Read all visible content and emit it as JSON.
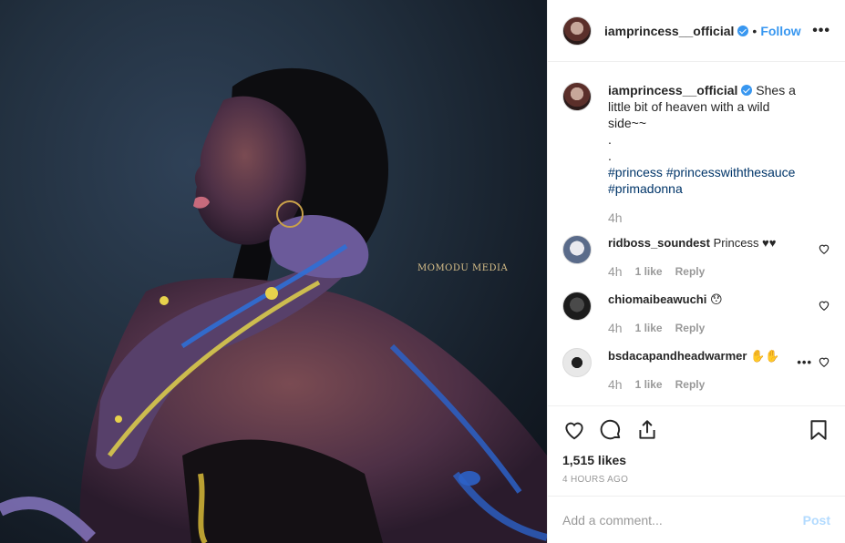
{
  "photo": {
    "watermark": "MOMODU MEDIA"
  },
  "header": {
    "username": "iamprincess__official",
    "separator": "•",
    "follow_label": "Follow",
    "more_label": "•••"
  },
  "caption": {
    "username": "iamprincess__official",
    "text": "Shes a little bit of heaven with a wild side~~",
    "line2": ".",
    "line3": ".",
    "hashtags": [
      "#princess",
      "#princesswiththesauce",
      "#primadonna"
    ],
    "time": "4h"
  },
  "comments": [
    {
      "username": "ridboss_soundest",
      "text": "Princess ♥♥",
      "time": "4h",
      "likes": "1 like",
      "reply": "Reply"
    },
    {
      "username": "chiomaibeawuchi",
      "text": "😯",
      "time": "4h",
      "likes": "1 like",
      "reply": "Reply"
    },
    {
      "username": "bsdacapandheadwarmer",
      "text": "✋✋",
      "time": "4h",
      "likes": "1 like",
      "reply": "Reply",
      "more": "•••"
    }
  ],
  "actions": {
    "icons": [
      "heart-icon",
      "comment-icon",
      "share-icon",
      "bookmark-icon"
    ],
    "likes": "1,515 likes",
    "posted_ago": "4 HOURS AGO"
  },
  "add_comment": {
    "placeholder": "Add a comment...",
    "post_label": "Post"
  },
  "colors": {
    "accent": "#3897f0",
    "hashtag": "#003569",
    "muted": "#999999",
    "post_disabled": "#b3dbff"
  }
}
